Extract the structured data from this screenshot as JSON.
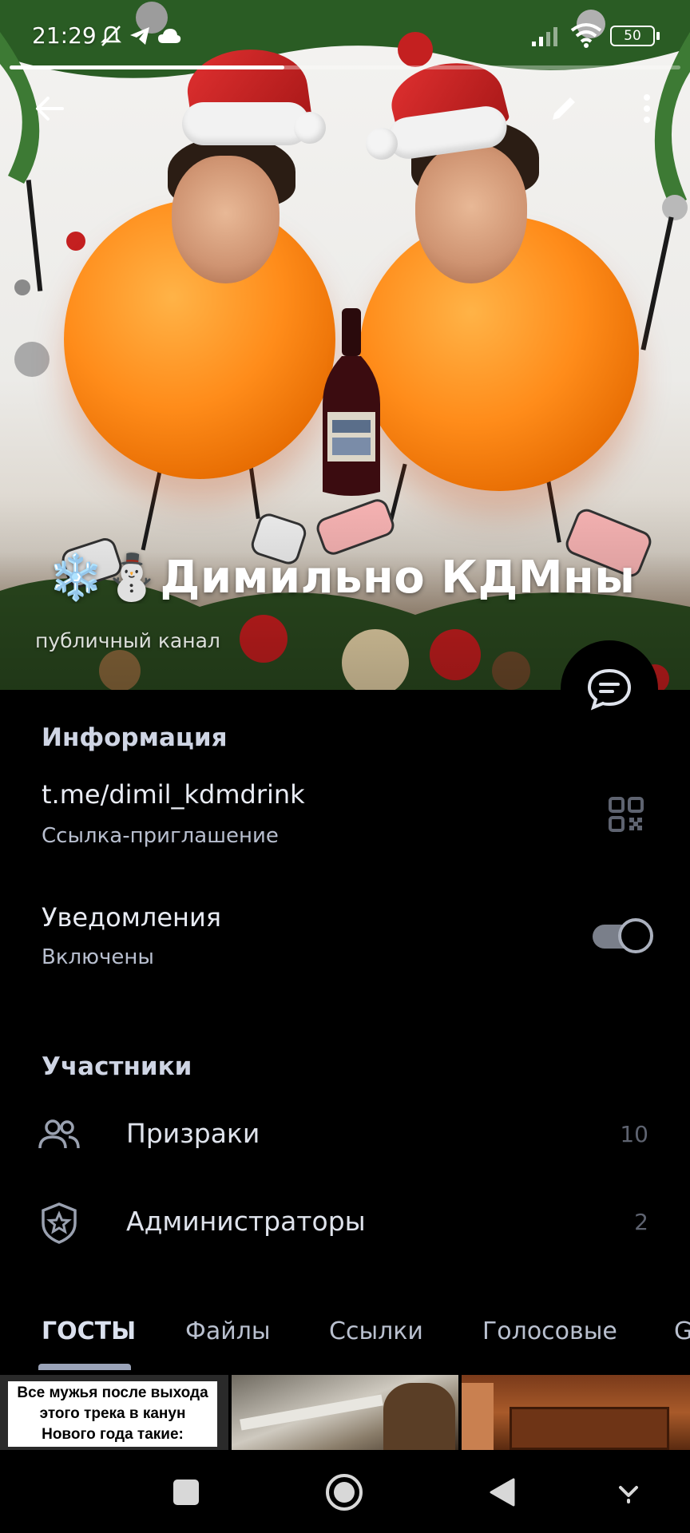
{
  "status_bar": {
    "time": "21:29",
    "battery": "50"
  },
  "channel": {
    "emoji_prefix": "❄️⛄",
    "name": "Димильно КДМны",
    "type_label": "публичный канал"
  },
  "story_progress": 0.41,
  "info": {
    "section_title": "Информация",
    "link": "t.me/dimil_kdmdrink",
    "link_caption": "Ссылка-приглашение"
  },
  "notifications": {
    "title": "Уведомления",
    "state": "Включены",
    "enabled": true
  },
  "members": {
    "section_title": "Участники",
    "items": [
      {
        "label": "Призраки",
        "count": "10",
        "icon": "people-icon"
      },
      {
        "label": "Администраторы",
        "count": "2",
        "icon": "shield-star-icon"
      }
    ]
  },
  "tabs": [
    {
      "label": "ГОСТЫ",
      "active": true
    },
    {
      "label": "Файлы",
      "active": false
    },
    {
      "label": "Ссылки",
      "active": false
    },
    {
      "label": "Голосовые",
      "active": false
    },
    {
      "label": "G",
      "active": false
    }
  ],
  "media": {
    "meme_caption": "Все мужья после выхода этого трека в канун Нового года такие:"
  },
  "colors": {
    "background": "#000000",
    "section_title": "#cfd5e4",
    "muted_count": "#5e6370"
  }
}
